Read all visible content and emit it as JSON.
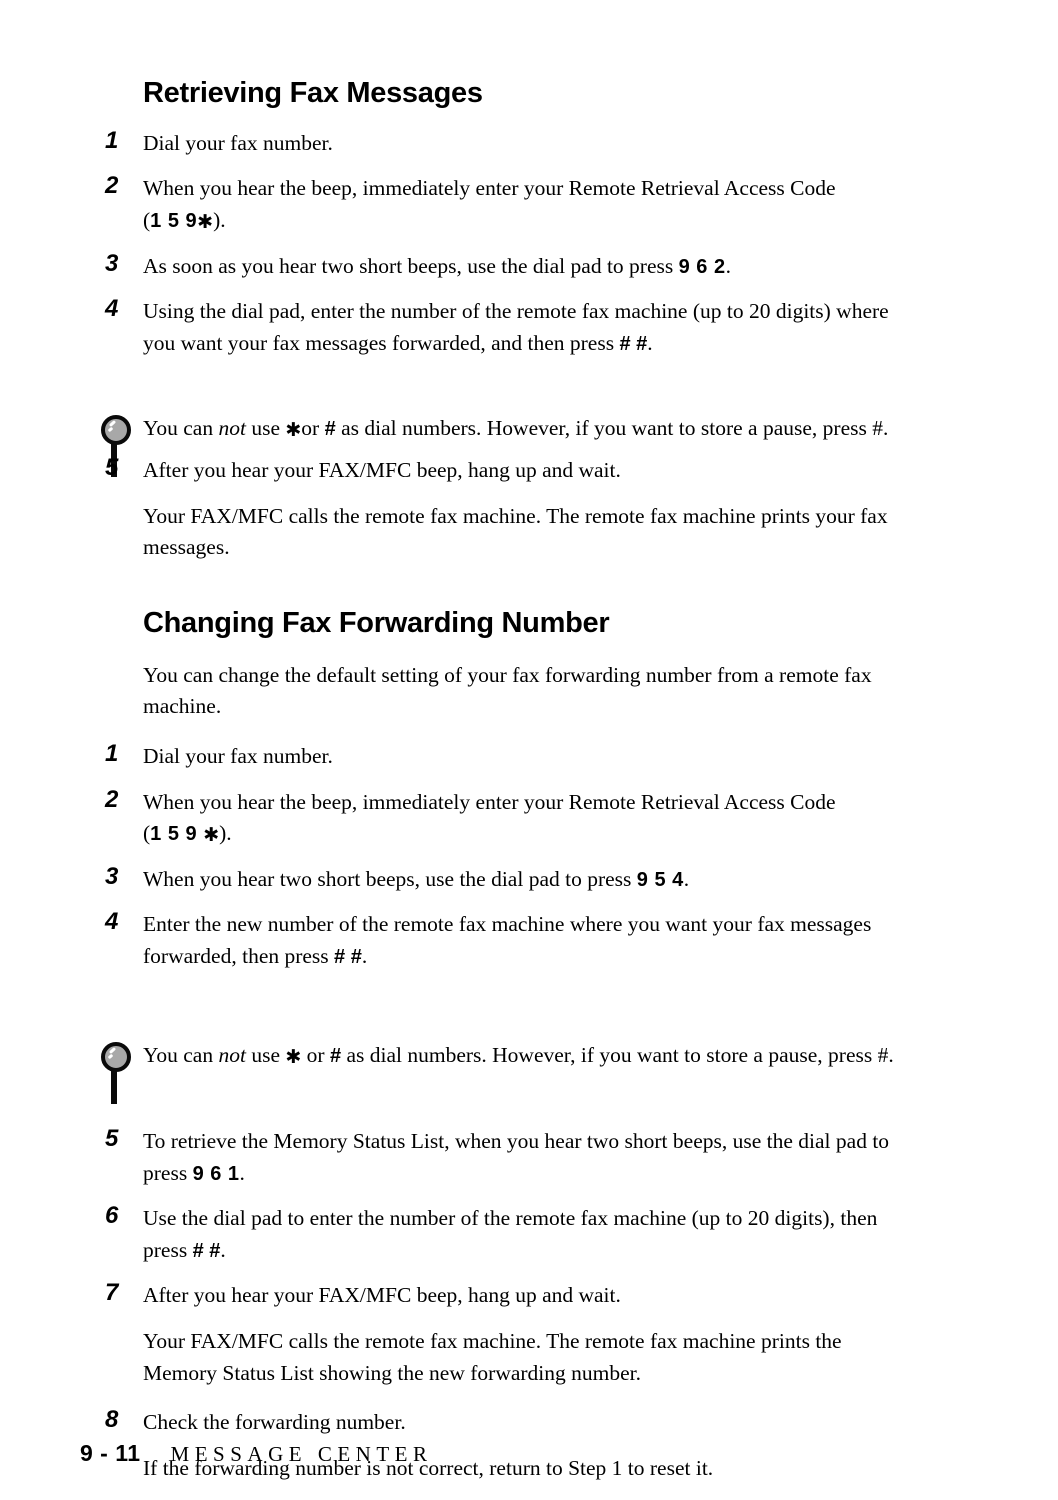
{
  "page": {
    "folio": "9 - 11",
    "footer_title": "MESSAGE CENTER"
  },
  "sections": [
    {
      "heading": "Retrieving Fax Messages",
      "steps": [
        {
          "num": "1",
          "text": "Dial your fax number."
        },
        {
          "num": "2",
          "text": "When you hear the beep, immediately enter your Remote Retrieval Access Code",
          "code_line_prefix": "(",
          "code": "1 5 9",
          "code_star": "✱",
          "code_line_suffix": ")."
        },
        {
          "num": "3",
          "text_before": "As soon as you hear two short beeps, use the dial pad to press ",
          "keys": "9 6 2",
          "text_after": "."
        },
        {
          "num": "4",
          "text_before": "Using the dial pad, enter the number of the remote fax machine (up to 20 digits) where you want your fax messages forwarded, and then press ",
          "keys": "# #",
          "text_after": "."
        }
      ],
      "note": {
        "a": "You can ",
        "italic": "not",
        "b": " use ",
        "star": "✱",
        "c": "or ",
        "hash": "#",
        "d": " as dial numbers. However, if you want to store a pause, press #."
      },
      "steps_after": [
        {
          "num": "5",
          "text": "After you hear your FAX/MFC beep, hang up and wait."
        }
      ],
      "paragraph": "Your FAX/MFC calls the remote fax machine.  The remote fax machine prints your fax messages."
    },
    {
      "heading": "Changing Fax Forwarding Number",
      "intro": "You can change the default setting of your fax forwarding number from a remote fax machine.",
      "steps": [
        {
          "num": "1",
          "text": "Dial your fax number."
        },
        {
          "num": "2",
          "text": "When you hear the beep, immediately enter your Remote Retrieval Access Code",
          "code_line_prefix": "(",
          "code": "1 5 9 ",
          "code_star": "✱",
          "code_line_suffix": ")."
        },
        {
          "num": "3",
          "text_before": "When you hear two short beeps, use the dial pad to press ",
          "keys": "9 5 4",
          "text_after": "."
        },
        {
          "num": "4",
          "text_before": "Enter the new number of the remote fax machine where you want your fax messages forwarded, then press ",
          "keys": "# #",
          "text_after": "."
        }
      ],
      "note": {
        "a": "You can ",
        "italic": "not",
        "b": " use ",
        "star": "✱",
        "c": " or ",
        "hash": "#",
        "d": " as dial numbers.  However, if you want to store a pause, press #."
      },
      "steps_after": [
        {
          "num": "5",
          "text_before": "To retrieve the Memory Status List, when you hear two short beeps, use the dial pad to press ",
          "keys": "9 6 1",
          "text_after": "."
        },
        {
          "num": "6",
          "text_before": "Use the dial pad to enter the number of the remote fax machine (up to 20 digits), then press ",
          "keys": "# #",
          "text_after": "."
        },
        {
          "num": "7",
          "text": "After you hear your FAX/MFC beep, hang up and wait."
        }
      ],
      "paragraph": "Your FAX/MFC calls the remote fax machine. The remote fax machine prints the Memory Status List showing the new forwarding number.",
      "steps_final": [
        {
          "num": "8",
          "text": "Check the forwarding number."
        }
      ],
      "paragraph2": "If the forwarding number is not correct, return to Step 1 to reset it."
    }
  ]
}
